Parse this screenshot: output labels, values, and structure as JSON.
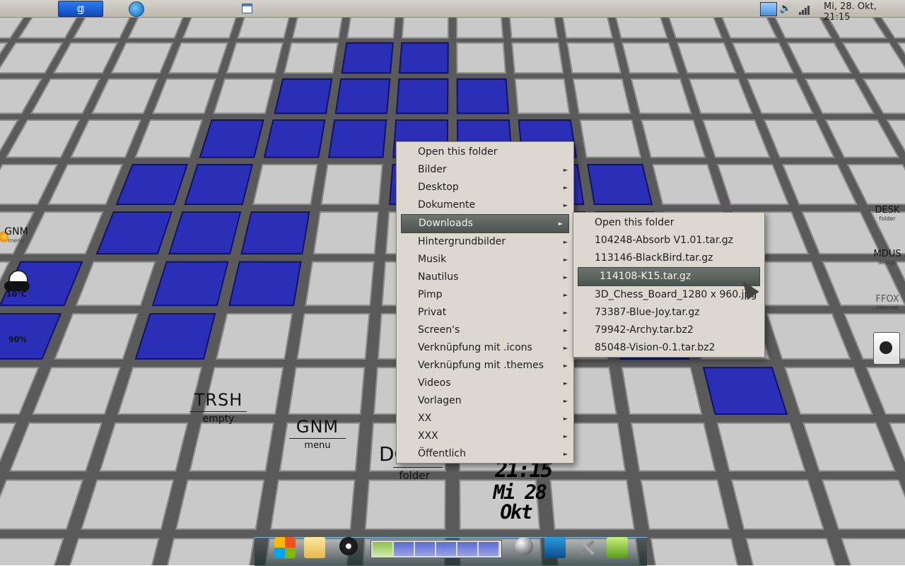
{
  "panel": {
    "clock": "Mi, 28. Okt, 21:15",
    "menu_button_glyph": "𝕘"
  },
  "desktop": {
    "left_gnm": {
      "title": "GNM",
      "sub": "menu"
    },
    "weather_temp": "10°C",
    "battery": "90%",
    "trsh": {
      "title": "TRSH",
      "sub": "empty"
    },
    "gnm_center": {
      "title": "GNM",
      "sub": "menu"
    },
    "folder_widget": {
      "title": "DO",
      "sub": "folder"
    },
    "big_clock": {
      "time": "21:15",
      "date": "Mi 28 Okt"
    },
    "right": [
      {
        "title": "DESK",
        "sub": "folder"
      },
      {
        "title": "MDUS",
        "sub": "design"
      },
      {
        "title": "FFOX",
        "sub": "internet"
      }
    ]
  },
  "context_menu": {
    "items": [
      {
        "label": "Open this folder",
        "has_sub": false
      },
      {
        "label": "Bilder",
        "has_sub": true
      },
      {
        "label": "Desktop",
        "has_sub": true
      },
      {
        "label": "Dokumente",
        "has_sub": true
      },
      {
        "label": "Downloads",
        "has_sub": true,
        "highlighted": true
      },
      {
        "label": "Hintergrundbilder",
        "has_sub": true
      },
      {
        "label": "Musik",
        "has_sub": true
      },
      {
        "label": "Nautilus",
        "has_sub": true
      },
      {
        "label": "Pimp",
        "has_sub": true
      },
      {
        "label": "Privat",
        "has_sub": true
      },
      {
        "label": "Screen's",
        "has_sub": true
      },
      {
        "label": "Verknüpfung mit .icons",
        "has_sub": true
      },
      {
        "label": "Verknüpfung mit .themes",
        "has_sub": true
      },
      {
        "label": "Videos",
        "has_sub": true
      },
      {
        "label": "Vorlagen",
        "has_sub": true
      },
      {
        "label": "XX",
        "has_sub": true
      },
      {
        "label": "XXX",
        "has_sub": true
      },
      {
        "label": "Öffentlich",
        "has_sub": true
      }
    ],
    "arrow_glyph": "►"
  },
  "submenu": {
    "items": [
      {
        "label": "Open this folder"
      },
      {
        "label": "104248-Absorb V1.01.tar.gz"
      },
      {
        "label": "113146-BlackBird.tar.gz"
      },
      {
        "label": "114108-K15.tar.gz",
        "highlighted": true
      },
      {
        "label": "3D_Chess_Board_1280 x 960.jpg"
      },
      {
        "label": "73387-Blue-Joy.tar.gz"
      },
      {
        "label": "79942-Archy.tar.bz2"
      },
      {
        "label": "85048-Vision-0.1.tar.bz2"
      }
    ]
  },
  "colors": {
    "tile_light": "#c9c9c9",
    "tile_blue": "#2b2fb8",
    "menu_bg": "#dcd8cf",
    "menu_highlight": "#5a615d"
  }
}
